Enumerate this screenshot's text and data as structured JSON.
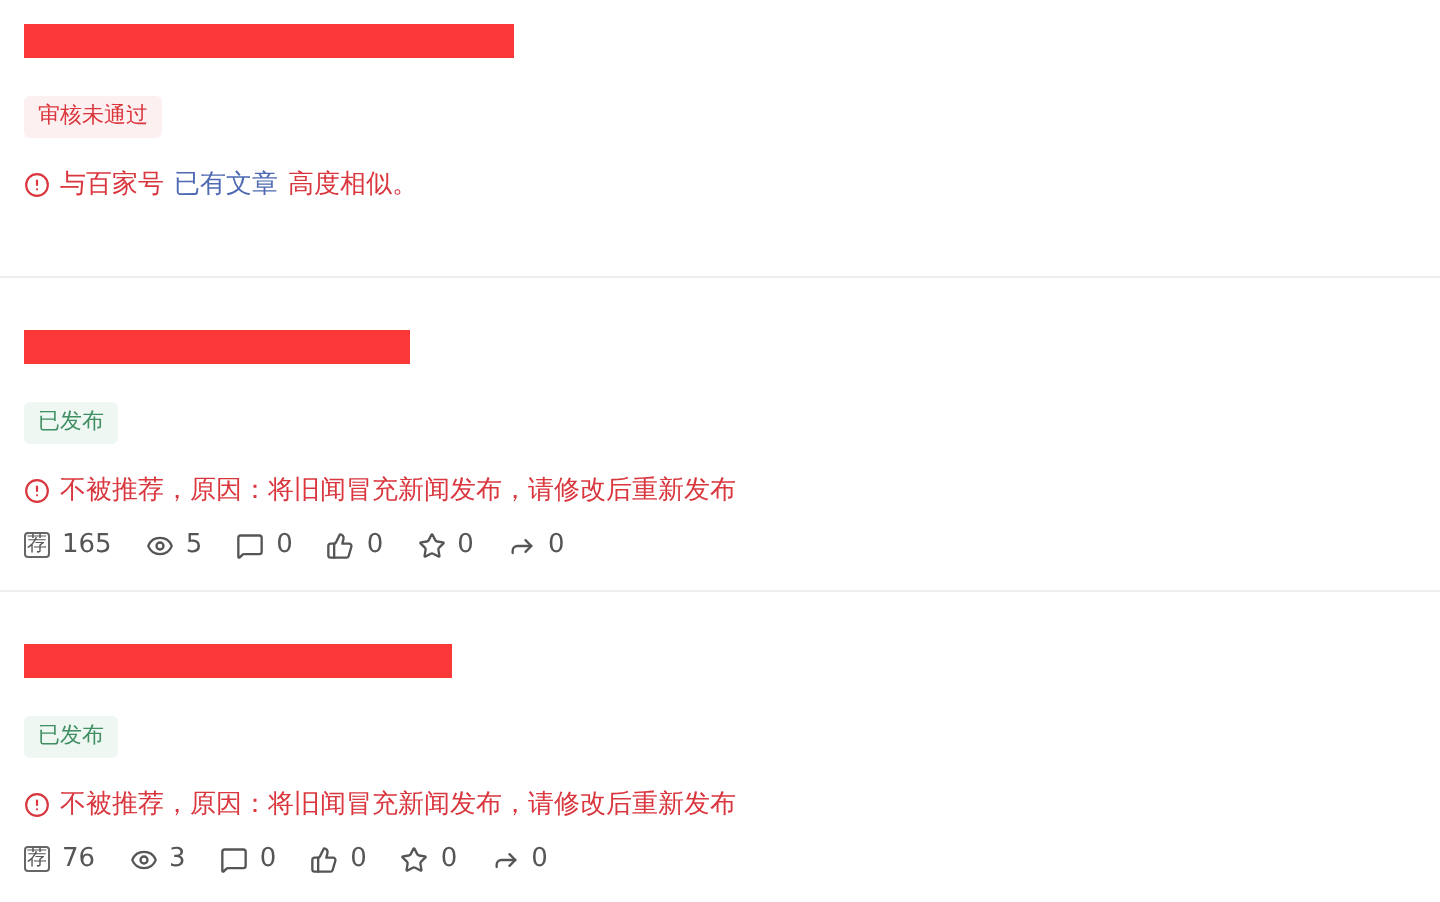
{
  "articles": [
    {
      "status": {
        "label": "审核未通过",
        "kind": "rejected"
      },
      "notice": [
        {
          "kind": "text",
          "text": "与百家号"
        },
        {
          "kind": "link",
          "text": "已有文章"
        },
        {
          "kind": "text",
          "text": "高度相似。"
        }
      ]
    },
    {
      "status": {
        "label": "已发布",
        "kind": "published"
      },
      "notice": [
        {
          "kind": "text",
          "text": "不被推荐，原因：将旧闻冒充新闻发布，请修改后重新发布"
        }
      ],
      "stats": [
        {
          "kind": "recommend",
          "glyph": "荐",
          "value": "165"
        },
        {
          "kind": "views",
          "value": "5"
        },
        {
          "kind": "comments",
          "value": "0"
        },
        {
          "kind": "likes",
          "value": "0"
        },
        {
          "kind": "favorites",
          "value": "0"
        },
        {
          "kind": "shares",
          "value": "0"
        }
      ]
    },
    {
      "status": {
        "label": "已发布",
        "kind": "published"
      },
      "notice": [
        {
          "kind": "text",
          "text": "不被推荐，原因：将旧闻冒充新闻发布，请修改后重新发布"
        }
      ],
      "stats": [
        {
          "kind": "recommend",
          "glyph": "荐",
          "value": "76"
        },
        {
          "kind": "views",
          "value": "3"
        },
        {
          "kind": "comments",
          "value": "0"
        },
        {
          "kind": "likes",
          "value": "0"
        },
        {
          "kind": "favorites",
          "value": "0"
        },
        {
          "kind": "shares",
          "value": "0"
        }
      ]
    }
  ]
}
